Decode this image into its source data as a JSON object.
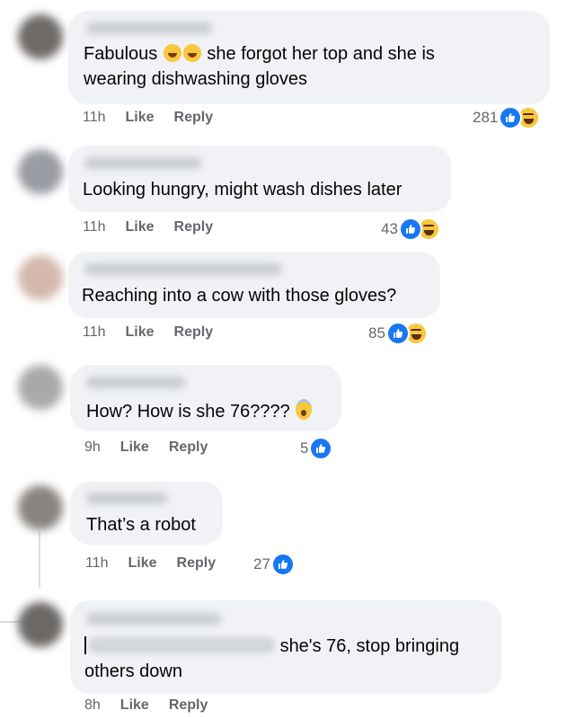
{
  "comments": [
    {
      "text_before": "Fabulous",
      "text_after": "she forgot her top and she is",
      "text_line2": "wearing dishwashing gloves",
      "time": "11h",
      "like": "Like",
      "reply": "Reply",
      "reactions": "281",
      "icons": [
        "like-icon",
        "haha-icon"
      ],
      "emoji": [
        "rolling-laughing-icon",
        "rolling-laughing-icon"
      ]
    },
    {
      "text": "Looking hungry, might wash dishes later",
      "time": "11h",
      "like": "Like",
      "reply": "Reply",
      "reactions": "43"
    },
    {
      "text": "Reaching into a cow with those gloves?",
      "time": "11h",
      "like": "Like",
      "reply": "Reply",
      "reactions": "85"
    },
    {
      "text": "How? How is she 76????",
      "time": "9h",
      "like": "Like",
      "reply": "Reply",
      "reactions": "5"
    },
    {
      "text": "That’s a robot",
      "time": "11h",
      "like": "Like",
      "reply": "Reply",
      "reactions": "27"
    },
    {
      "text_after": "she's 76, stop bringing",
      "text_line2": "others down",
      "time": "8h",
      "like": "Like",
      "reply": "Reply"
    }
  ],
  "colors": {
    "like_blue": "#1877f2",
    "bubble_bg": "#f0f2f5",
    "meta_gray": "#65676b"
  }
}
